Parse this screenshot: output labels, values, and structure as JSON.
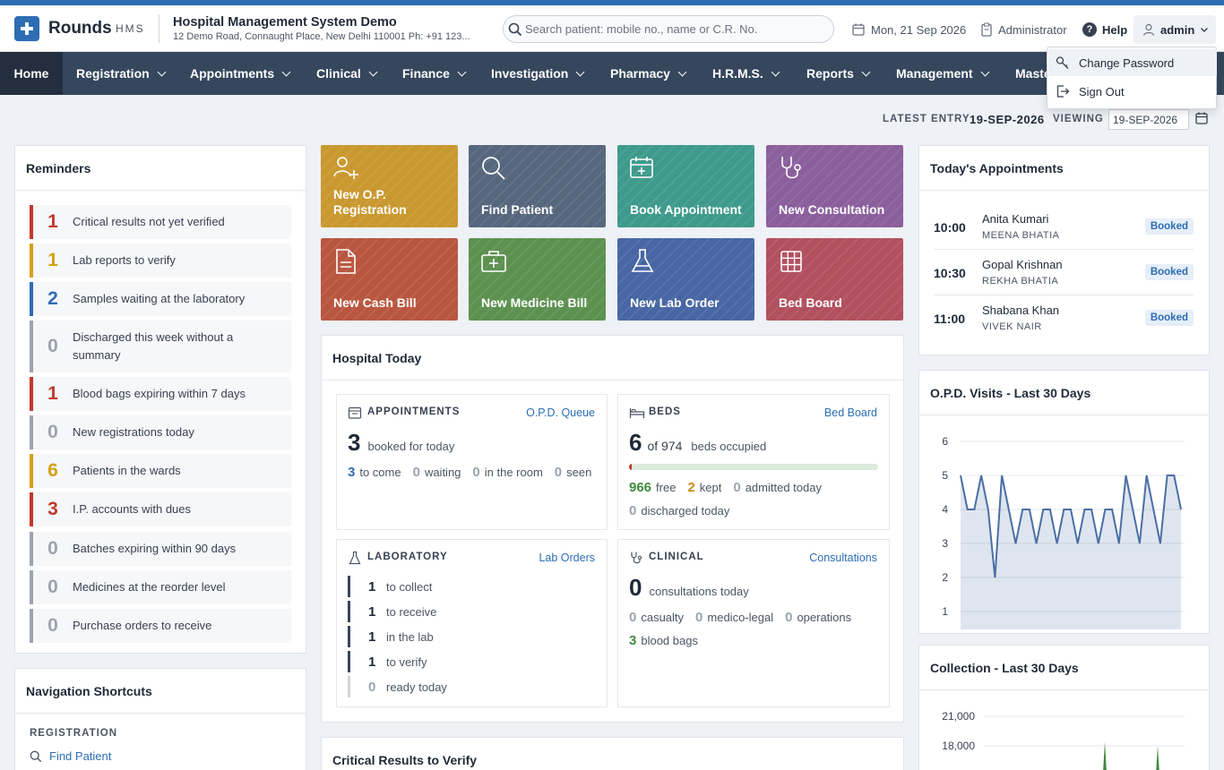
{
  "header": {
    "brand": "Rounds",
    "brand_sub": "HMS",
    "hospital_name": "Hospital Management System Demo",
    "hospital_address": "12 Demo Road, Connaught Place, New Delhi 110001 Ph: +91 123...",
    "search_placeholder": "Search patient: mobile no., name or C.R. No.",
    "date": "Mon, 21 Sep 2026",
    "role": "Administrator",
    "help": "Help",
    "user": "admin"
  },
  "user_menu": {
    "change_password": "Change Password",
    "sign_out": "Sign Out"
  },
  "nav": {
    "home": "Home",
    "registration": "Registration",
    "appointments": "Appointments",
    "clinical": "Clinical",
    "finance": "Finance",
    "investigation": "Investigation",
    "pharmacy": "Pharmacy",
    "hrms": "H.R.M.S.",
    "reports": "Reports",
    "management": "Management",
    "masters": "Maste"
  },
  "entry": {
    "latest_label": "LATEST ENTRY",
    "latest_value": "19-SEP-2026",
    "viewing_label": "VIEWING",
    "viewing_value": "19-SEP-2026"
  },
  "reminders": {
    "title": "Reminders",
    "items": [
      {
        "count": "1",
        "text": "Critical results not yet verified",
        "color": "#c0392b"
      },
      {
        "count": "1",
        "text": "Lab reports to verify",
        "color": "#d4a017"
      },
      {
        "count": "2",
        "text": "Samples waiting at the laboratory",
        "color": "#2d6db3"
      },
      {
        "count": "0",
        "text": "Discharged this week without a summary",
        "color": "#9ca3af"
      },
      {
        "count": "1",
        "text": "Blood bags expiring within 7 days",
        "color": "#c0392b"
      },
      {
        "count": "0",
        "text": "New registrations today",
        "color": "#9ca3af"
      },
      {
        "count": "6",
        "text": "Patients in the wards",
        "color": "#d4a017"
      },
      {
        "count": "3",
        "text": "I.P. accounts with dues",
        "color": "#c0392b"
      },
      {
        "count": "0",
        "text": "Batches expiring within 90 days",
        "color": "#9ca3af"
      },
      {
        "count": "0",
        "text": "Medicines at the reorder level",
        "color": "#9ca3af"
      },
      {
        "count": "0",
        "text": "Purchase orders to receive",
        "color": "#9ca3af"
      }
    ]
  },
  "shortcuts": {
    "title": "Navigation Shortcuts",
    "section": "REGISTRATION",
    "link": "Find Patient"
  },
  "tiles": {
    "new_opd": "New O.P. Registration",
    "find_patient": "Find Patient",
    "book_appointment": "Book Appointment",
    "new_consultation": "New Consultation",
    "new_cash_bill": "New Cash Bill",
    "new_medicine_bill": "New Medicine Bill",
    "new_lab_order": "New Lab Order",
    "bed_board": "Bed Board",
    "colors": [
      "#c9982f",
      "#56667d",
      "#3e9a8c",
      "#8a5f9c",
      "#b9563f",
      "#5c9150",
      "#4866a4",
      "#b2505f"
    ]
  },
  "hospital_today": {
    "title": "Hospital Today",
    "appointments": {
      "title": "APPOINTMENTS",
      "link": "O.P.D. Queue",
      "booked": "3",
      "booked_label": "booked for today",
      "to_come": "3",
      "to_come_label": "to come",
      "waiting": "0",
      "waiting_label": "waiting",
      "in_room": "0",
      "in_room_label": "in the room",
      "seen": "0",
      "seen_label": "seen"
    },
    "beds": {
      "title": "BEDS",
      "link": "Bed Board",
      "occupied": "6",
      "of_total": "of 974",
      "occupied_label": "beds occupied",
      "occupancy_fraction": 0.006,
      "free": "966",
      "free_label": "free",
      "kept": "2",
      "kept_label": "kept",
      "admitted": "0",
      "admitted_label": "admitted today",
      "discharged": "0",
      "discharged_label": "discharged today"
    },
    "laboratory": {
      "title": "LABORATORY",
      "link": "Lab Orders",
      "rows": [
        {
          "n": "1",
          "label": "to collect"
        },
        {
          "n": "1",
          "label": "to receive"
        },
        {
          "n": "1",
          "label": "in the lab"
        },
        {
          "n": "1",
          "label": "to verify"
        },
        {
          "n": "0",
          "label": "ready today"
        }
      ]
    },
    "clinical": {
      "title": "CLINICAL",
      "link": "Consultations",
      "consultations": "0",
      "consultations_label": "consultations today",
      "casualty": "0",
      "casualty_label": "casualty",
      "medico_legal": "0",
      "medico_legal_label": "medico-legal",
      "operations": "0",
      "operations_label": "operations",
      "blood_bags": "3",
      "blood_bags_label": "blood bags"
    }
  },
  "critical": {
    "title": "Critical Results to Verify"
  },
  "appointments_today": {
    "title": "Today's Appointments",
    "items": [
      {
        "time": "10:00",
        "name": "Anita Kumari",
        "doctor": "MEENA BHATIA",
        "status": "Booked"
      },
      {
        "time": "10:30",
        "name": "Gopal Krishnan",
        "doctor": "REKHA BHATIA",
        "status": "Booked"
      },
      {
        "time": "11:00",
        "name": "Shabana Khan",
        "doctor": "VIVEK NAIR",
        "status": "Booked"
      }
    ]
  },
  "opd_chart": {
    "title": "O.P.D. Visits - Last 30 Days"
  },
  "collection_chart": {
    "title": "Collection - Last 30 Days"
  },
  "chart_data": [
    {
      "type": "area",
      "title": "O.P.D. Visits - Last 30 Days",
      "yticks": [
        "6",
        "5",
        "4",
        "3",
        "2",
        "1"
      ],
      "ylim": [
        1,
        6
      ],
      "values": [
        5,
        4,
        4,
        5,
        4,
        2,
        5,
        4,
        3,
        4,
        4,
        3,
        4,
        4,
        3,
        4,
        4,
        3,
        4,
        4,
        3,
        4,
        4,
        3,
        5,
        4,
        3,
        5,
        4,
        3,
        5,
        5,
        4
      ],
      "color": "#4a6fa5",
      "grid": true
    },
    {
      "type": "area",
      "title": "Collection - Last 30 Days",
      "yticks": [
        "21,000",
        "18,000"
      ],
      "color": "#3d8a3d",
      "grid": true
    }
  ]
}
